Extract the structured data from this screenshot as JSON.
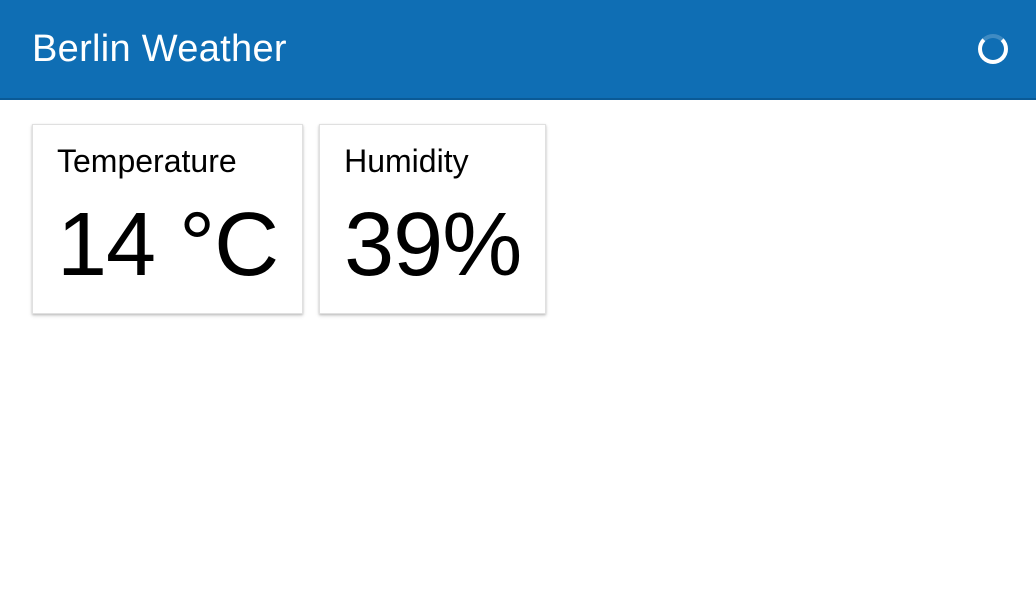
{
  "header": {
    "title": "Berlin Weather"
  },
  "cards": [
    {
      "label": "Temperature",
      "value": "14 °C"
    },
    {
      "label": "Humidity",
      "value": "39%"
    }
  ]
}
